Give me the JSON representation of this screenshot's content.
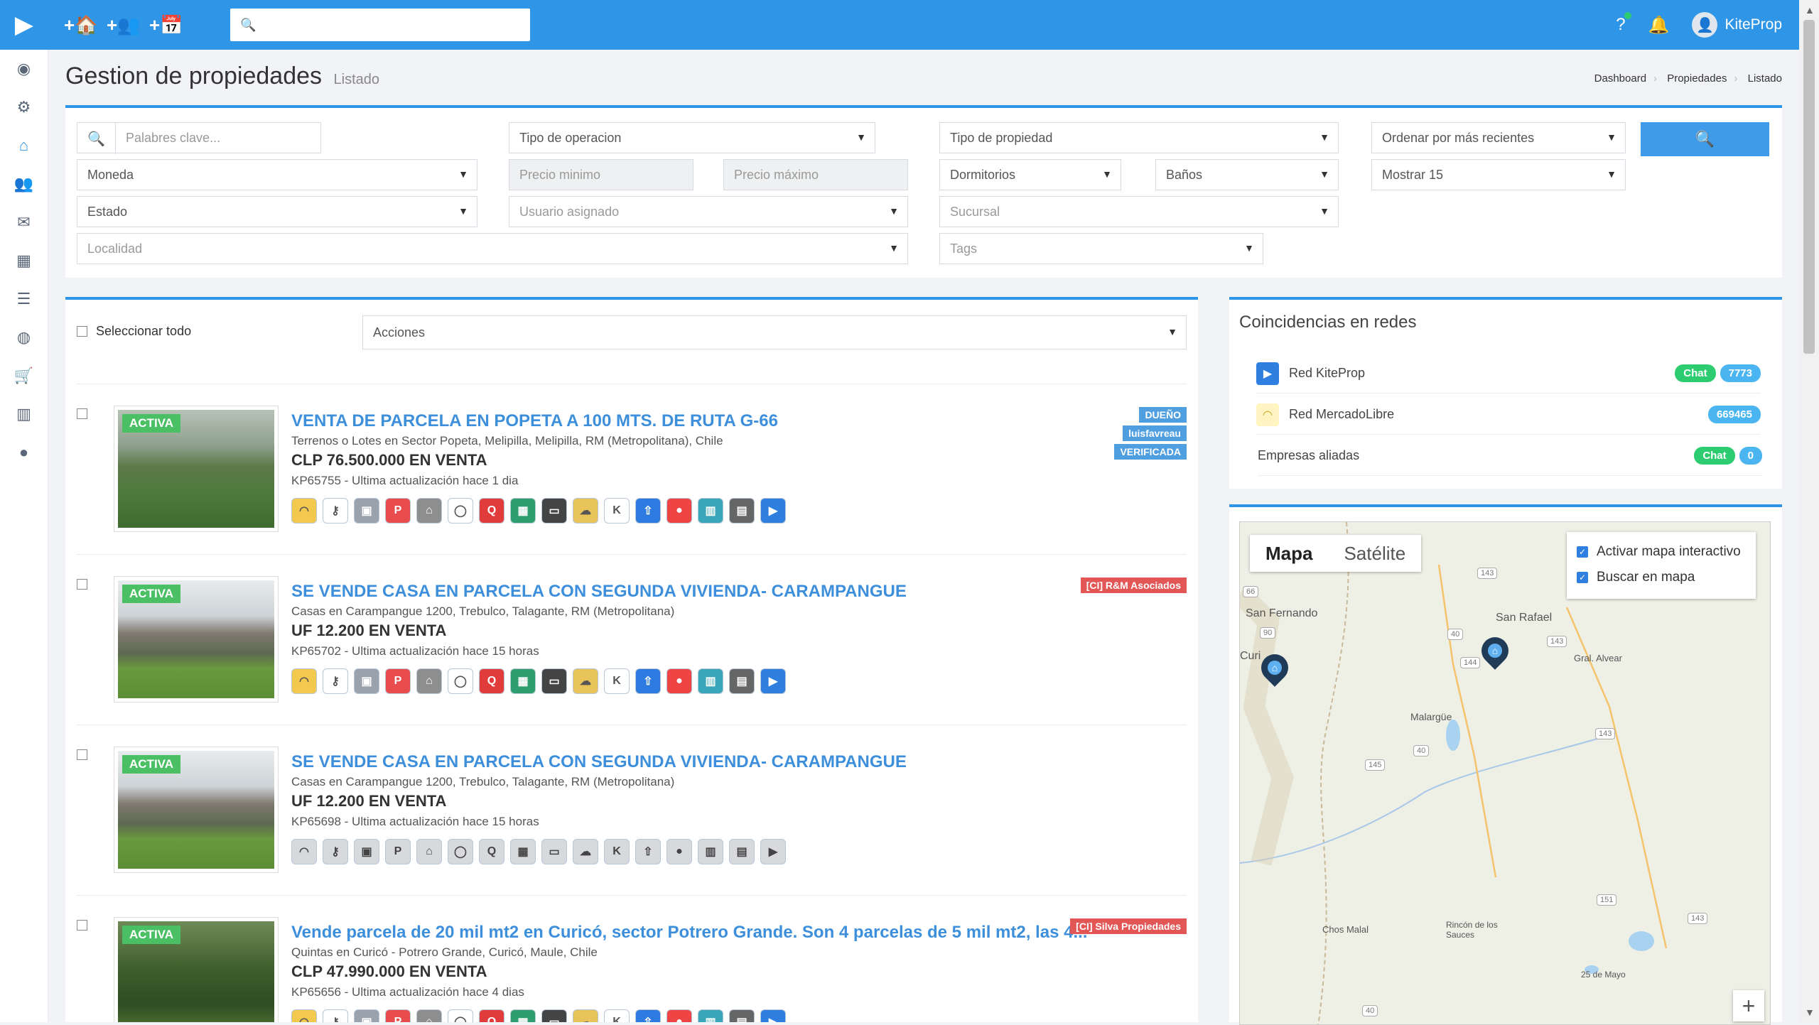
{
  "topbar": {
    "logo": "▶",
    "quick": [
      "+🏠",
      "+👥",
      "+📅"
    ],
    "search_icon": "🔍",
    "search_value": "",
    "help": "?",
    "bell": "🔔",
    "avatar": "👤",
    "user": "KiteProp"
  },
  "sidenav": [
    {
      "icon": "dashboard-icon",
      "glyph": "◉"
    },
    {
      "icon": "settings-icon",
      "glyph": "⚙"
    },
    {
      "icon": "home-icon",
      "glyph": "⌂"
    },
    {
      "icon": "users-icon",
      "glyph": "👥"
    },
    {
      "icon": "mail-icon",
      "glyph": "✉"
    },
    {
      "icon": "calendar-icon",
      "glyph": "▦"
    },
    {
      "icon": "list-icon",
      "glyph": "☰"
    },
    {
      "icon": "globe-icon",
      "glyph": "◍"
    },
    {
      "icon": "cart-icon",
      "glyph": "🛒"
    },
    {
      "icon": "building-icon",
      "glyph": "▥"
    },
    {
      "icon": "person-icon",
      "glyph": "●"
    }
  ],
  "page": {
    "title": "Gestion de propiedades",
    "subtitle": "Listado",
    "breadcrumb": [
      "Dashboard",
      "Propiedades",
      "Listado"
    ]
  },
  "filters": {
    "keywords_placeholder": "Palabres clave...",
    "tipo_operacion": "Tipo de operacion",
    "tipo_propiedad": "Tipo de propiedad",
    "orden": "Ordenar por más recientes",
    "moneda": "Moneda",
    "precio_min": "Precio minimo",
    "precio_max": "Precio máximo",
    "dormitorios": "Dormitorios",
    "banos": "Baños",
    "mostrar": "Mostrar 15",
    "estado": "Estado",
    "usuario": "Usuario asignado",
    "sucursal": "Sucursal",
    "localidad": "Localidad",
    "tags": "Tags",
    "search_btn": "🔍"
  },
  "listing": {
    "select_all": "Seleccionar todo",
    "actions": "Acciones"
  },
  "properties": [
    {
      "status": "ACTIVA",
      "title": "VENTA DE PARCELA EN POPETA A 100 MTS. DE RUTA G-66",
      "address": "Terrenos o Lotes en Sector Popeta, Melipilla, Melipilla, RM (Metropolitana), Chile",
      "price": "CLP 76.500.000 EN VENTA",
      "code": "KP65755 - Ultima actualización hace 1 dia",
      "tags": [
        {
          "text": "DUEÑO",
          "color": "blue"
        },
        {
          "text": "luisfavreau",
          "color": "blue"
        },
        {
          "text": "VERIFICADA",
          "color": "blue"
        }
      ],
      "img": "field",
      "portals_active": true
    },
    {
      "status": "ACTIVA",
      "title": "SE VENDE CASA EN PARCELA CON SEGUNDA VIVIENDA- CARAMPANGUE",
      "address": "Casas en Carampangue 1200, Trebulco, Talagante, RM (Metropolitana)",
      "price": "UF 12.200 EN VENTA",
      "code": "KP65702 - Ultima actualización hace 15 horas",
      "tags": [
        {
          "text": "[CI] R&M Asociados",
          "color": "red"
        }
      ],
      "img": "house",
      "portals_active": true
    },
    {
      "status": "ACTIVA",
      "title": "SE VENDE CASA EN PARCELA CON SEGUNDA VIVIENDA- CARAMPANGUE",
      "address": "Casas en Carampangue 1200, Trebulco, Talagante, RM (Metropolitana)",
      "price": "UF 12.200 EN VENTA",
      "code": "KP65698 - Ultima actualización hace 15 horas",
      "tags": [],
      "img": "house",
      "portals_active": false
    },
    {
      "status": "ACTIVA",
      "title": "Vende parcela de 20 mil mt2 en Curicó, sector Potrero Grande. Son 4 parcelas de 5 mil mt2, las 4...",
      "address": "Quintas en Curicó - Potrero Grande, Curicó, Maule, Chile",
      "price": "CLP 47.990.000 EN VENTA",
      "code": "KP65656 - Ultima actualización hace 4 dias",
      "tags": [
        {
          "text": "[CI] Silva Propiedades",
          "color": "red"
        }
      ],
      "img": "forest",
      "portals_active": true
    }
  ],
  "portals": [
    {
      "name": "mercadolibre-icon",
      "glyph": "◠",
      "color": "#f2c94c"
    },
    {
      "name": "key-icon",
      "glyph": "⚷",
      "color": "#ffffff"
    },
    {
      "name": "camera-icon",
      "glyph": "▣",
      "color": "#9aa3ad"
    },
    {
      "name": "p-icon",
      "glyph": "P",
      "color": "#e84c4c"
    },
    {
      "name": "house-portal-icon",
      "glyph": "⌂",
      "color": "#8e8e8e"
    },
    {
      "name": "circle-portal-icon",
      "glyph": "◯",
      "color": "#ffffff"
    },
    {
      "name": "q-icon",
      "glyph": "Q",
      "color": "#e23b3b"
    },
    {
      "name": "grid-portal-icon",
      "glyph": "▦",
      "color": "#2f9e6e"
    },
    {
      "name": "tv-icon",
      "glyph": "▭",
      "color": "#444444"
    },
    {
      "name": "cloud-icon",
      "glyph": "☁",
      "color": "#e8c35a"
    },
    {
      "name": "k-icon",
      "glyph": "K",
      "color": "#ffffff"
    },
    {
      "name": "arrow-up-portal-icon",
      "glyph": "⇧",
      "color": "#2d7be0"
    },
    {
      "name": "record-icon",
      "glyph": "●",
      "color": "#ef4444"
    },
    {
      "name": "building-portal-icon",
      "glyph": "▥",
      "color": "#3aa6b9"
    },
    {
      "name": "dialog-icon",
      "glyph": "▤",
      "color": "#666666"
    },
    {
      "name": "kiteprop-portal-icon",
      "glyph": "▶",
      "color": "#2f7fe0"
    }
  ],
  "redes": {
    "title": "Coincidencias en redes",
    "rows": [
      {
        "name": "Red KiteProp",
        "icon": "kiteprop-icon",
        "chat": "Chat",
        "count": "7773"
      },
      {
        "name": "Red MercadoLibre",
        "icon": "mercadolibre-icon",
        "chat": "",
        "count": "669465"
      },
      {
        "name": "Empresas aliadas",
        "icon": "",
        "chat": "Chat",
        "count": "0"
      }
    ]
  },
  "map": {
    "tab_map": "Mapa",
    "tab_sat": "Satélite",
    "opt1": "Activar mapa interactivo",
    "opt2": "Buscar en mapa",
    "labels": [
      "San Fernando",
      "San Rafael",
      "Gral. Alvear",
      "Malargüe",
      "Chos Malal",
      "Rincón de los Sauces",
      "25 de Mayo",
      "Curi"
    ],
    "shields": [
      "143",
      "66",
      "90",
      "40",
      "144",
      "143",
      "40",
      "145",
      "143",
      "151",
      "143",
      "40"
    ],
    "zoom": "+"
  }
}
